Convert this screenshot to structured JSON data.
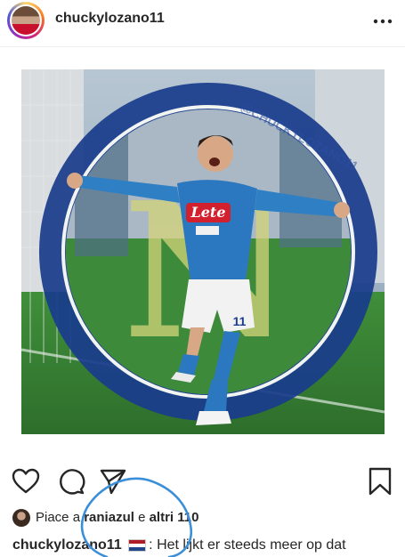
{
  "post": {
    "username": "chuckylozano11",
    "image_watermark": "@CHUCKYLOZANO11",
    "jersey_sponsor": "Lete",
    "shirt_number": "11",
    "badge_letter": "N"
  },
  "actions": {
    "like_icon": "heart-icon",
    "comment_icon": "comment-icon",
    "share_icon": "paper-plane-icon",
    "save_icon": "bookmark-icon"
  },
  "likes": {
    "prefix": "Piace a",
    "liker": "raniazul",
    "connector": "e",
    "others": "altri 110"
  },
  "caption": {
    "username": "chuckylozano11",
    "text": ": Het lijkt er steeds meer op dat"
  },
  "colors": {
    "napoli_blue": "#1a3c8c",
    "scribble_blue": "#3b8fd9"
  }
}
